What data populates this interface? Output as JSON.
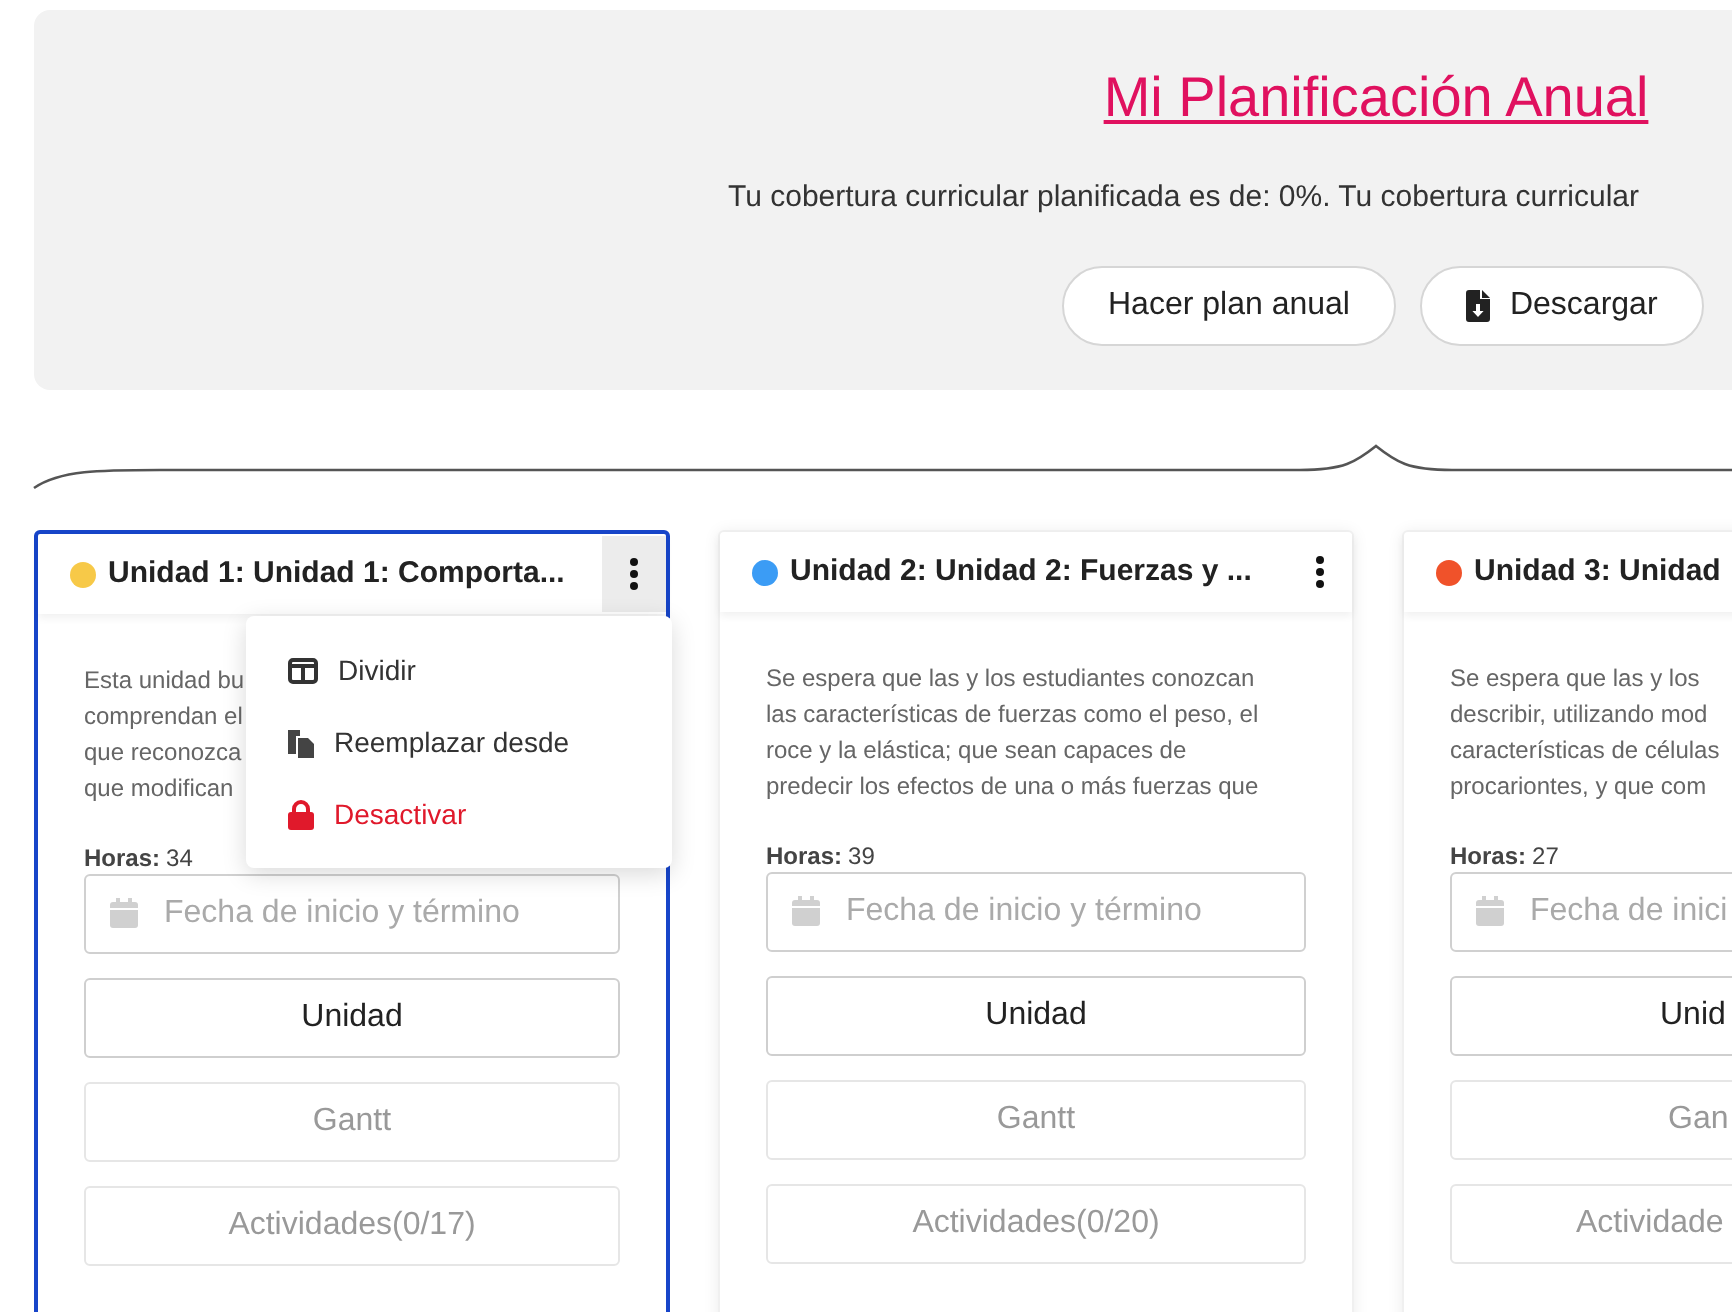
{
  "header": {
    "title": "Mi Planificación Anual",
    "coverage_text": "Tu cobertura curricular planificada es de: 0%. Tu cobertura curricular",
    "buttons": [
      {
        "label": "Hacer plan anual",
        "kind": "plain"
      },
      {
        "label": "Descargar",
        "kind": "download"
      }
    ]
  },
  "units": [
    {
      "title": "Unidad 1: Unidad 1: Comporta...",
      "color": "#f7c948",
      "selected": true,
      "menu_button": true,
      "menu_open": true,
      "description_lines": [
        "Esta unidad bu",
        "comprendan el",
        "que reconozca",
        "que modifican"
      ],
      "hours_label": "Horas:",
      "hours": "34",
      "date_placeholder": "Fecha de inicio y término",
      "buttons": [
        {
          "label": "Unidad",
          "disabled": false
        },
        {
          "label": "Gantt",
          "disabled": true
        },
        {
          "label": "Actividades(0/17)",
          "disabled": true
        }
      ],
      "menu": [
        {
          "label": "Dividir",
          "kind": "split",
          "danger": false
        },
        {
          "label": "Reemplazar desde",
          "kind": "copy",
          "danger": false
        },
        {
          "label": "Desactivar",
          "kind": "lock",
          "danger": true
        }
      ]
    },
    {
      "title": "Unidad 2: Unidad 2: Fuerzas y ...",
      "color": "#3b9cf5",
      "selected": false,
      "menu_button": true,
      "menu_open": false,
      "description_lines": [
        "Se espera que las y los estudiantes conozcan",
        "las características de fuerzas como el peso, el",
        "roce y la elástica; que sean capaces de",
        "predecir los efectos de una o más fuerzas que"
      ],
      "hours_label": "Horas:",
      "hours": "39",
      "date_placeholder": "Fecha de inicio y término",
      "buttons": [
        {
          "label": "Unidad",
          "disabled": false
        },
        {
          "label": "Gantt",
          "disabled": true
        },
        {
          "label": "Actividades(0/20)",
          "disabled": true
        }
      ]
    },
    {
      "title": "Unidad 3: Unidad",
      "color": "#f0522a",
      "selected": false,
      "menu_button": false,
      "menu_open": false,
      "description_lines": [
        "Se espera que las y los",
        "describir, utilizando mod",
        "características de células",
        "procariontes, y que com"
      ],
      "hours_label": "Horas:",
      "hours": "27",
      "date_placeholder": "Fecha de inici",
      "buttons": [
        {
          "label": "Unid",
          "disabled": false
        },
        {
          "label": "Gan",
          "disabled": true
        },
        {
          "label": "Actividade",
          "disabled": true
        }
      ]
    }
  ]
}
